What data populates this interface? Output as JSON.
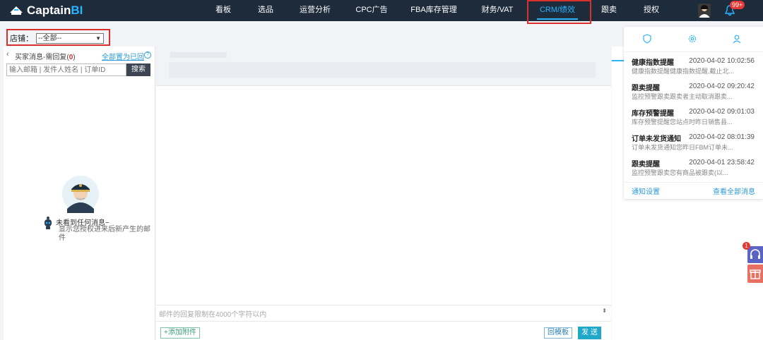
{
  "brand": {
    "name_main": "Captain",
    "name_accent": "BI"
  },
  "nav": {
    "items": [
      {
        "label": "看板"
      },
      {
        "label": "选品"
      },
      {
        "label": "运营分析"
      },
      {
        "label": "CPC广告"
      },
      {
        "label": "FBA库存管理"
      },
      {
        "label": "财务/VAT"
      },
      {
        "label": "CRM/绩效",
        "active": true
      },
      {
        "label": "跟卖"
      },
      {
        "label": "授权"
      }
    ],
    "notification_badge": "99+"
  },
  "store": {
    "label": "店铺：",
    "selected": "--全部--"
  },
  "inbox": {
    "title": "买家消息-需回复",
    "count_open": "(",
    "count": "0",
    "count_close": ")",
    "mark_all_read": "全部置为已回",
    "help_icon": "?",
    "search_placeholder": "输入邮箱 | 发件人姓名 | 订单ID",
    "search_button": "搜索",
    "empty_title": "未看到任何消息~",
    "empty_desc": "显示您授权进来后新产生的邮件"
  },
  "composer": {
    "placeholder": "邮件的回复限制在4000个字符以内",
    "attach_label": "+添加附件",
    "template_label": "回模板",
    "send_label": "发 送"
  },
  "notifications": {
    "tab_icons": [
      "shield-icon",
      "gear-icon",
      "user-icon"
    ],
    "items": [
      {
        "title": "健康指数提醒",
        "time": "2020-04-02 10:02:56",
        "snippet": "健康指数提醒健康指数提醒,截止北..."
      },
      {
        "title": "跟卖提醒",
        "time": "2020-04-02 09:20:42",
        "snippet": "监控预警跟卖跟卖者主动取消跟卖..."
      },
      {
        "title": "库存预警提醒",
        "time": "2020-04-02 09:01:03",
        "snippet": "库存预警提醒您站点时昨日销售县..."
      },
      {
        "title": "订单未发货通知",
        "time": "2020-04-02 08:01:39",
        "snippet": "订单未发货通知您昨日FBM订单未..."
      },
      {
        "title": "跟卖提醒",
        "time": "2020-04-01 23:58:42",
        "snippet": "监控预警跟卖您有商品被跟卖(以..."
      }
    ],
    "settings_link": "通知设置",
    "view_all_link": "查看全部消息"
  },
  "floating": {
    "support_badge": "1"
  },
  "colors": {
    "topbar": "#1d2b3a",
    "accent": "#2ab3ff",
    "highlight_box": "#d9302c",
    "send": "#1fa8c9"
  }
}
